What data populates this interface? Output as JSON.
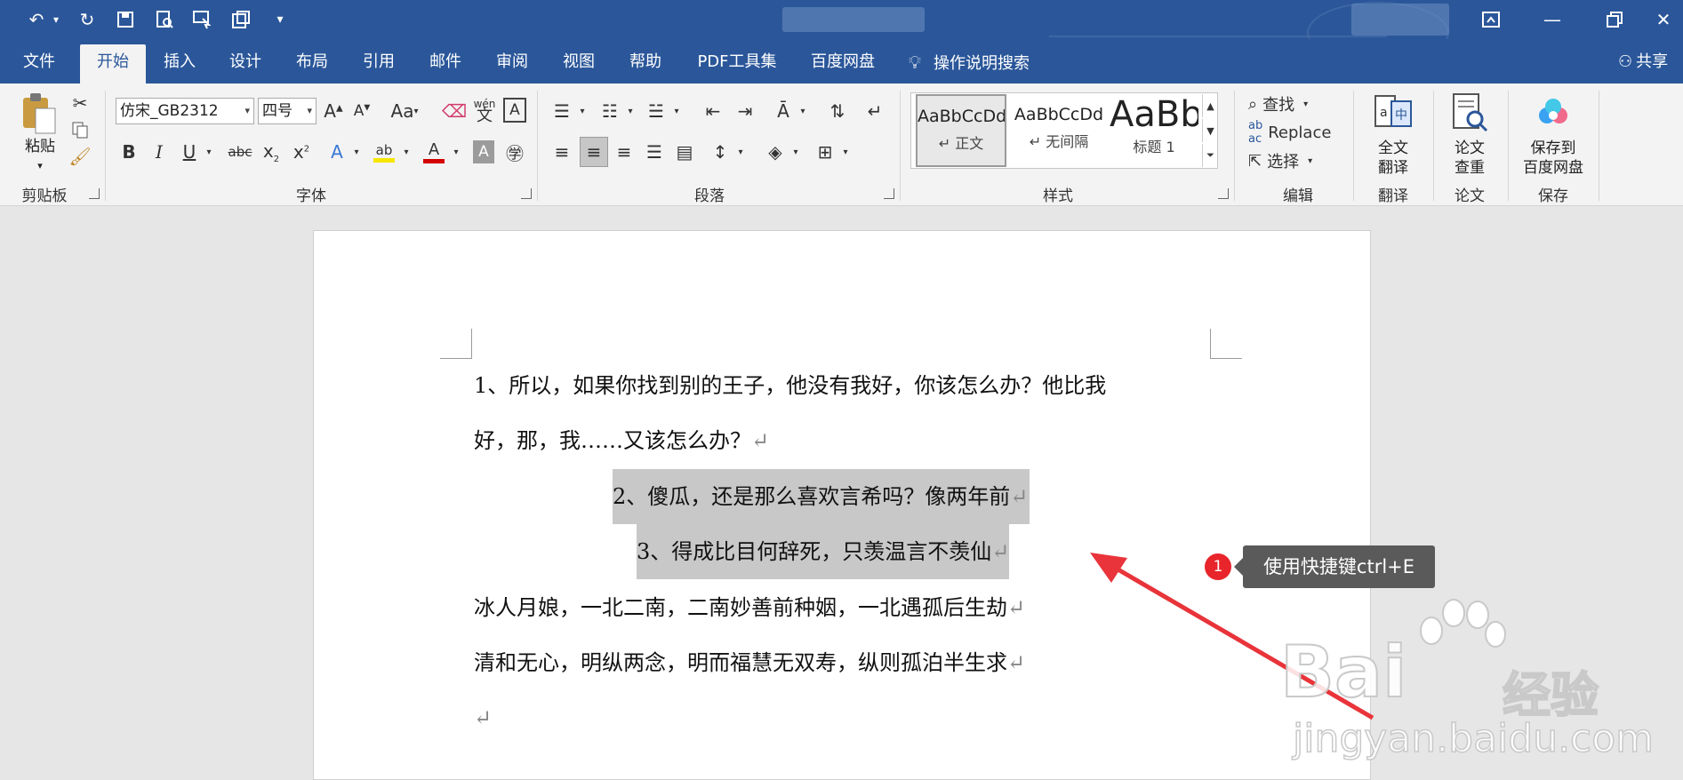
{
  "titlebar": {
    "qa_icons": [
      "undo-icon",
      "redo-icon",
      "save-icon",
      "print-preview-icon",
      "touch-mode-icon",
      "form-icon",
      "customize-icon"
    ]
  },
  "menu": {
    "tabs": [
      "文件",
      "开始",
      "插入",
      "设计",
      "布局",
      "引用",
      "邮件",
      "审阅",
      "视图",
      "帮助",
      "PDF工具集",
      "百度网盘"
    ],
    "active_tab": "开始",
    "search_hint": "操作说明搜索",
    "share": "共享"
  },
  "ribbon": {
    "clipboard": {
      "paste": "粘贴",
      "label": "剪贴板"
    },
    "font": {
      "name": "仿宋_GB2312",
      "size": "四号",
      "case_btn": "Aa",
      "phonetic_top": "wén",
      "phonetic_bottom": "文",
      "label": "字体",
      "highlight_color": "#f7e600",
      "font_color": "#d40000"
    },
    "paragraph": {
      "label": "段落"
    },
    "styles": {
      "items": [
        {
          "sample": "AaBbCcDd",
          "name": "正文"
        },
        {
          "sample": "AaBbCcDd",
          "name": "无间隔"
        },
        {
          "sample": "AaBb",
          "name": "标题 1"
        }
      ],
      "label": "样式"
    },
    "editing": {
      "find": "查找",
      "replace": "Replace",
      "select": "选择",
      "label": "编辑"
    },
    "translate": {
      "line1": "全文",
      "line2": "翻译",
      "label": "翻译"
    },
    "thesis": {
      "line1": "论文",
      "line2": "查重",
      "label": "论文"
    },
    "save": {
      "line1": "保存到",
      "line2": "百度网盘",
      "label": "保存"
    }
  },
  "document": {
    "lines": [
      "1、所以，如果你找到别的王子，他没有我好，你该怎么办？他比我",
      "好，那，我……又该怎么办？",
      "2、傻瓜，还是那么喜欢言希吗？像两年前",
      "3、得成比目何辞死，只羡温言不羡仙",
      "冰人月娘，一北二南，二南妙善前种姻，一北遇孤后生劫",
      "清和无心，明纵两念，明而福慧无双寿，纵则孤泊半生求"
    ],
    "para_mark": "↵"
  },
  "annotation": {
    "number": "1",
    "text": "使用快捷键ctrl+E",
    "arrow_color": "#e8343a"
  },
  "watermark": {
    "brand": "Bai",
    "cn": "经验",
    "url": "jingyan.baidu.com"
  }
}
